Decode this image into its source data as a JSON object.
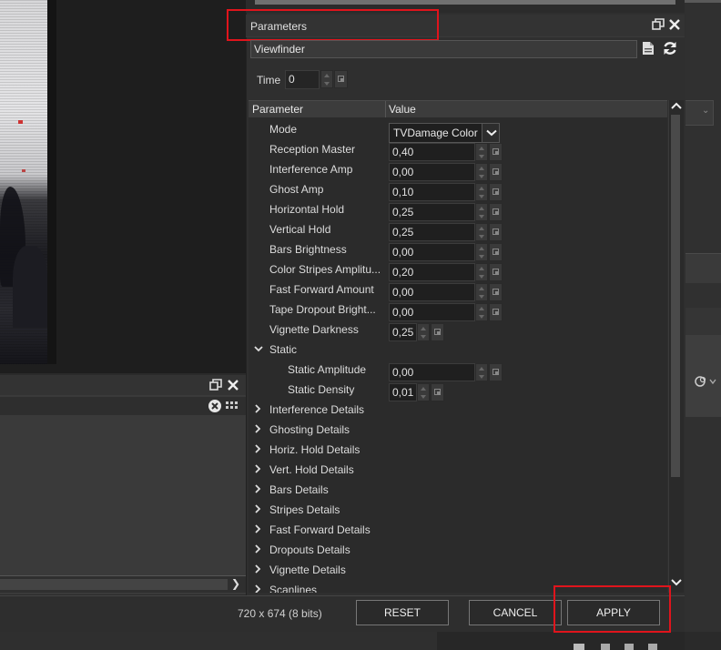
{
  "params": {
    "title": "Parameters",
    "preset_name": "Viewfinder",
    "time_label": "Time",
    "time_value": "0",
    "col_parameter": "Parameter",
    "col_value": "Value",
    "mode_label": "Mode",
    "mode_value": "TVDamage Color",
    "rows": [
      {
        "label": "Reception Master",
        "value": "0,40"
      },
      {
        "label": "Interference Amp",
        "value": "0,00"
      },
      {
        "label": "Ghost Amp",
        "value": "0,10"
      },
      {
        "label": "Horizontal Hold",
        "value": "0,25"
      },
      {
        "label": "Vertical Hold",
        "value": "0,25"
      },
      {
        "label": "Bars Brightness",
        "value": "0,00"
      },
      {
        "label": "Color Stripes Amplitu...",
        "value": "0,20"
      },
      {
        "label": "Fast Forward Amount",
        "value": "0,00"
      },
      {
        "label": "Tape Dropout Bright...",
        "value": "0,00"
      },
      {
        "label": "Vignette Darkness",
        "value": "0,25"
      }
    ],
    "static_group": "Static",
    "static_rows": [
      {
        "label": "Static Amplitude",
        "value": "0,00"
      },
      {
        "label": "Static Density",
        "value": "0,01"
      }
    ],
    "groups": [
      "Interference Details",
      "Ghosting Details",
      "Horiz. Hold Details",
      "Vert. Hold Details",
      "Bars Details",
      "Stripes Details",
      "Fast Forward Details",
      "Dropouts Details",
      "Vignette Details",
      "Scanlines"
    ]
  },
  "bottom": {
    "image_info": "720 x 674 (8 bits)",
    "reset_label": "RESET",
    "cancel_label": "CANCEL",
    "apply_label": "APPLY"
  },
  "colors": {
    "highlight": "#e0141c",
    "panel_bg": "#2f2f2f",
    "field_bg": "#1f1f1f"
  }
}
